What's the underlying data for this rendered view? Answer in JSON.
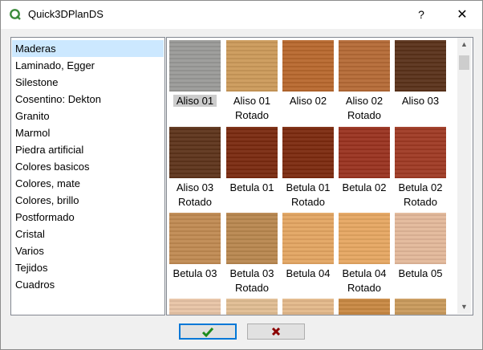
{
  "window": {
    "title": "Quick3DPlanDS",
    "help_label": "?",
    "close_label": "✕"
  },
  "categories": [
    {
      "label": "Maderas",
      "selected": true
    },
    {
      "label": "Laminado, Egger"
    },
    {
      "label": "Silestone"
    },
    {
      "label": "Cosentino: Dekton"
    },
    {
      "label": "Granito"
    },
    {
      "label": "Marmol"
    },
    {
      "label": "Piedra artificial"
    },
    {
      "label": "Colores basicos"
    },
    {
      "label": "Colores, mate"
    },
    {
      "label": "Colores, brillo"
    },
    {
      "label": "Postformado"
    },
    {
      "label": "Cristal"
    },
    {
      "label": "Varios"
    },
    {
      "label": "Tejidos"
    },
    {
      "label": "Cuadros"
    }
  ],
  "materials": [
    {
      "label": "Aliso 01",
      "color": "#9a9a98",
      "selected": true
    },
    {
      "label": "Aliso 01 Rotado",
      "color": "#cc9a5a"
    },
    {
      "label": "Aliso 02",
      "color": "#b8682e"
    },
    {
      "label": "Aliso 02 Rotado",
      "color": "#b56a36"
    },
    {
      "label": "Aliso 03",
      "color": "#5a321a"
    },
    {
      "label": "Aliso 03 Rotado",
      "color": "#5e341b"
    },
    {
      "label": "Betula 01",
      "color": "#7a2a10"
    },
    {
      "label": "Betula 01 Rotado",
      "color": "#7c2a0f"
    },
    {
      "label": "Betula 02",
      "color": "#9a3320"
    },
    {
      "label": "Betula 02 Rotado",
      "color": "#9f3a24"
    },
    {
      "label": "Betula 03",
      "color": "#c08a52"
    },
    {
      "label": "Betula 03 Rotado",
      "color": "#b8874f"
    },
    {
      "label": "Betula 04",
      "color": "#e3a562"
    },
    {
      "label": "Betula 04 Rotado",
      "color": "#e6a762"
    },
    {
      "label": "Betula 05",
      "color": "#e3b89a"
    },
    {
      "label": "",
      "color": "#e8c4a6"
    },
    {
      "label": "",
      "color": "#e0bd92"
    },
    {
      "label": "",
      "color": "#e3b88a"
    },
    {
      "label": "",
      "color": "#c88842"
    },
    {
      "label": "",
      "color": "#c99a5c"
    }
  ],
  "buttons": {
    "ok_icon": "check-icon",
    "cancel_icon": "x-icon"
  },
  "colors": {
    "accent": "#0078d7",
    "selection": "#cce8ff",
    "ok_green": "#1e8c1e",
    "cancel_red": "#8b0000"
  }
}
